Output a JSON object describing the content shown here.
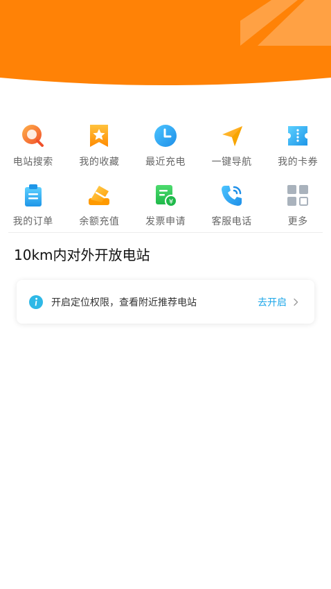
{
  "colors": {
    "header_orange": "#FF8206",
    "link_blue": "#1EA7E8"
  },
  "quick_menu": {
    "row1": [
      {
        "label": "电站搜索",
        "icon": "search-icon"
      },
      {
        "label": "我的收藏",
        "icon": "favorite-star-icon"
      },
      {
        "label": "最近充电",
        "icon": "clock-icon"
      },
      {
        "label": "一键导航",
        "icon": "navigation-arrow-icon"
      },
      {
        "label": "我的卡券",
        "icon": "coupon-icon"
      }
    ],
    "row2": [
      {
        "label": "我的订单",
        "icon": "order-clipboard-icon"
      },
      {
        "label": "余额充值",
        "icon": "wallet-card-icon"
      },
      {
        "label": "发票申请",
        "icon": "invoice-yen-icon"
      },
      {
        "label": "客服电话",
        "icon": "phone-call-icon"
      },
      {
        "label": "更多",
        "icon": "more-grid-icon"
      }
    ]
  },
  "section": {
    "title": "10km内对外开放电站"
  },
  "location_prompt": {
    "message": "开启定位权限，查看附近推荐电站",
    "action": "去开启"
  }
}
